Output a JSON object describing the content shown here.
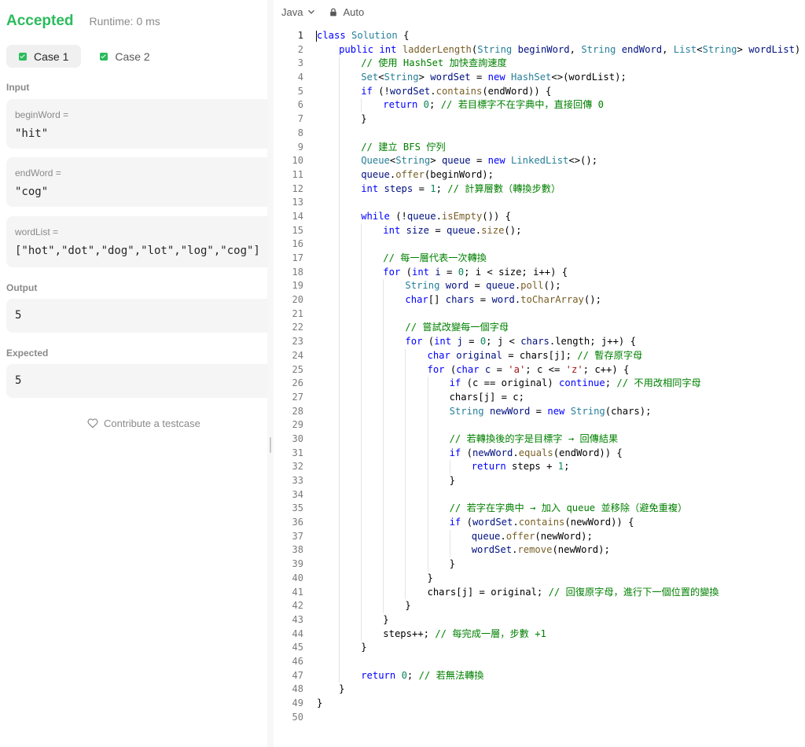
{
  "result": {
    "status": "Accepted",
    "runtime": "Runtime: 0 ms",
    "status_color": "#2cbb5d"
  },
  "cases": [
    {
      "label": "Case 1",
      "active": true
    },
    {
      "label": "Case 2",
      "active": false
    }
  ],
  "input": {
    "section_label": "Input",
    "params": [
      {
        "name": "beginWord =",
        "value": "\"hit\""
      },
      {
        "name": "endWord =",
        "value": "\"cog\""
      },
      {
        "name": "wordList =",
        "value": "[\"hot\",\"dot\",\"dog\",\"lot\",\"log\",\"cog\"]"
      }
    ]
  },
  "output": {
    "section_label": "Output",
    "value": "5"
  },
  "expected": {
    "section_label": "Expected",
    "value": "5"
  },
  "contribute_label": "Contribute a testcase",
  "editor": {
    "language": "Java",
    "mode": "Auto",
    "active_line": 1,
    "lines": [
      {
        "indent": 0,
        "tokens": [
          [
            "kw",
            "class"
          ],
          [
            "p",
            " "
          ],
          [
            "type",
            "Solution"
          ],
          [
            "p",
            " {"
          ]
        ]
      },
      {
        "indent": 1,
        "tokens": [
          [
            "kw",
            "public"
          ],
          [
            "p",
            " "
          ],
          [
            "kw",
            "int"
          ],
          [
            "p",
            " "
          ],
          [
            "fn",
            "ladderLength"
          ],
          [
            "p",
            "("
          ],
          [
            "type",
            "String"
          ],
          [
            "p",
            " "
          ],
          [
            "var",
            "beginWord"
          ],
          [
            "p",
            ", "
          ],
          [
            "type",
            "String"
          ],
          [
            "p",
            " "
          ],
          [
            "var",
            "endWord"
          ],
          [
            "p",
            ", "
          ],
          [
            "type",
            "List"
          ],
          [
            "p",
            "<"
          ],
          [
            "type",
            "String"
          ],
          [
            "p",
            "> "
          ],
          [
            "var",
            "wordList"
          ],
          [
            "p",
            ") {"
          ]
        ]
      },
      {
        "indent": 2,
        "tokens": [
          [
            "cm",
            "// 使用 HashSet 加快查詢速度"
          ]
        ]
      },
      {
        "indent": 2,
        "tokens": [
          [
            "type",
            "Set"
          ],
          [
            "p",
            "<"
          ],
          [
            "type",
            "String"
          ],
          [
            "p",
            "> "
          ],
          [
            "var",
            "wordSet"
          ],
          [
            "p",
            " = "
          ],
          [
            "kw",
            "new"
          ],
          [
            "p",
            " "
          ],
          [
            "type",
            "HashSet"
          ],
          [
            "p",
            "<>(wordList);"
          ]
        ]
      },
      {
        "indent": 2,
        "tokens": [
          [
            "kw",
            "if"
          ],
          [
            "p",
            " (!"
          ],
          [
            "var",
            "wordSet"
          ],
          [
            "p",
            "."
          ],
          [
            "fn",
            "contains"
          ],
          [
            "p",
            "(endWord)) {"
          ]
        ]
      },
      {
        "indent": 3,
        "tokens": [
          [
            "kw",
            "return"
          ],
          [
            "p",
            " "
          ],
          [
            "num",
            "0"
          ],
          [
            "p",
            "; "
          ],
          [
            "cm",
            "// 若目標字不在字典中，直接回傳 0"
          ]
        ]
      },
      {
        "indent": 2,
        "tokens": [
          [
            "p",
            "}"
          ]
        ]
      },
      {
        "indent": 0,
        "tokens": []
      },
      {
        "indent": 2,
        "tokens": [
          [
            "cm",
            "// 建立 BFS 佇列"
          ]
        ]
      },
      {
        "indent": 2,
        "tokens": [
          [
            "type",
            "Queue"
          ],
          [
            "p",
            "<"
          ],
          [
            "type",
            "String"
          ],
          [
            "p",
            "> "
          ],
          [
            "var",
            "queue"
          ],
          [
            "p",
            " = "
          ],
          [
            "kw",
            "new"
          ],
          [
            "p",
            " "
          ],
          [
            "type",
            "LinkedList"
          ],
          [
            "p",
            "<>();"
          ]
        ]
      },
      {
        "indent": 2,
        "tokens": [
          [
            "var",
            "queue"
          ],
          [
            "p",
            "."
          ],
          [
            "fn",
            "offer"
          ],
          [
            "p",
            "(beginWord);"
          ]
        ]
      },
      {
        "indent": 2,
        "tokens": [
          [
            "kw",
            "int"
          ],
          [
            "p",
            " "
          ],
          [
            "var",
            "steps"
          ],
          [
            "p",
            " = "
          ],
          [
            "num",
            "1"
          ],
          [
            "p",
            "; "
          ],
          [
            "cm",
            "// 計算層數（轉換步數）"
          ]
        ]
      },
      {
        "indent": 0,
        "tokens": []
      },
      {
        "indent": 2,
        "tokens": [
          [
            "kw",
            "while"
          ],
          [
            "p",
            " (!"
          ],
          [
            "var",
            "queue"
          ],
          [
            "p",
            "."
          ],
          [
            "fn",
            "isEmpty"
          ],
          [
            "p",
            "()) {"
          ]
        ]
      },
      {
        "indent": 3,
        "tokens": [
          [
            "kw",
            "int"
          ],
          [
            "p",
            " "
          ],
          [
            "var",
            "size"
          ],
          [
            "p",
            " = "
          ],
          [
            "var",
            "queue"
          ],
          [
            "p",
            "."
          ],
          [
            "fn",
            "size"
          ],
          [
            "p",
            "();"
          ]
        ]
      },
      {
        "indent": 0,
        "tokens": []
      },
      {
        "indent": 3,
        "tokens": [
          [
            "cm",
            "// 每一層代表一次轉換"
          ]
        ]
      },
      {
        "indent": 3,
        "tokens": [
          [
            "kw",
            "for"
          ],
          [
            "p",
            " ("
          ],
          [
            "kw",
            "int"
          ],
          [
            "p",
            " "
          ],
          [
            "var",
            "i"
          ],
          [
            "p",
            " = "
          ],
          [
            "num",
            "0"
          ],
          [
            "p",
            "; i < size; i++) {"
          ]
        ]
      },
      {
        "indent": 4,
        "tokens": [
          [
            "type",
            "String"
          ],
          [
            "p",
            " "
          ],
          [
            "var",
            "word"
          ],
          [
            "p",
            " = "
          ],
          [
            "var",
            "queue"
          ],
          [
            "p",
            "."
          ],
          [
            "fn",
            "poll"
          ],
          [
            "p",
            "();"
          ]
        ]
      },
      {
        "indent": 4,
        "tokens": [
          [
            "kw",
            "char"
          ],
          [
            "p",
            "[] "
          ],
          [
            "var",
            "chars"
          ],
          [
            "p",
            " = "
          ],
          [
            "var",
            "word"
          ],
          [
            "p",
            "."
          ],
          [
            "fn",
            "toCharArray"
          ],
          [
            "p",
            "();"
          ]
        ]
      },
      {
        "indent": 0,
        "tokens": []
      },
      {
        "indent": 4,
        "tokens": [
          [
            "cm",
            "// 嘗試改變每一個字母"
          ]
        ]
      },
      {
        "indent": 4,
        "tokens": [
          [
            "kw",
            "for"
          ],
          [
            "p",
            " ("
          ],
          [
            "kw",
            "int"
          ],
          [
            "p",
            " "
          ],
          [
            "var",
            "j"
          ],
          [
            "p",
            " = "
          ],
          [
            "num",
            "0"
          ],
          [
            "p",
            "; j < "
          ],
          [
            "var",
            "chars"
          ],
          [
            "p",
            ".length; j++) {"
          ]
        ]
      },
      {
        "indent": 5,
        "tokens": [
          [
            "kw",
            "char"
          ],
          [
            "p",
            " "
          ],
          [
            "var",
            "original"
          ],
          [
            "p",
            " = chars[j]; "
          ],
          [
            "cm",
            "// 暫存原字母"
          ]
        ]
      },
      {
        "indent": 5,
        "tokens": [
          [
            "kw",
            "for"
          ],
          [
            "p",
            " ("
          ],
          [
            "kw",
            "char"
          ],
          [
            "p",
            " "
          ],
          [
            "var",
            "c"
          ],
          [
            "p",
            " = "
          ],
          [
            "str",
            "'a'"
          ],
          [
            "p",
            "; c <= "
          ],
          [
            "str",
            "'z'"
          ],
          [
            "p",
            "; c++) {"
          ]
        ]
      },
      {
        "indent": 6,
        "tokens": [
          [
            "kw",
            "if"
          ],
          [
            "p",
            " (c == original) "
          ],
          [
            "kw",
            "continue"
          ],
          [
            "p",
            "; "
          ],
          [
            "cm",
            "// 不用改相同字母"
          ]
        ]
      },
      {
        "indent": 6,
        "tokens": [
          [
            "p",
            "chars[j] = c;"
          ]
        ]
      },
      {
        "indent": 6,
        "tokens": [
          [
            "type",
            "String"
          ],
          [
            "p",
            " "
          ],
          [
            "var",
            "newWord"
          ],
          [
            "p",
            " = "
          ],
          [
            "kw",
            "new"
          ],
          [
            "p",
            " "
          ],
          [
            "type",
            "String"
          ],
          [
            "p",
            "(chars);"
          ]
        ]
      },
      {
        "indent": 0,
        "tokens": []
      },
      {
        "indent": 6,
        "tokens": [
          [
            "cm",
            "// 若轉換後的字是目標字 → 回傳結果"
          ]
        ]
      },
      {
        "indent": 6,
        "tokens": [
          [
            "kw",
            "if"
          ],
          [
            "p",
            " ("
          ],
          [
            "var",
            "newWord"
          ],
          [
            "p",
            "."
          ],
          [
            "fn",
            "equals"
          ],
          [
            "p",
            "(endWord)) {"
          ]
        ]
      },
      {
        "indent": 7,
        "tokens": [
          [
            "kw",
            "return"
          ],
          [
            "p",
            " steps + "
          ],
          [
            "num",
            "1"
          ],
          [
            "p",
            ";"
          ]
        ]
      },
      {
        "indent": 6,
        "tokens": [
          [
            "p",
            "}"
          ]
        ]
      },
      {
        "indent": 0,
        "tokens": []
      },
      {
        "indent": 6,
        "tokens": [
          [
            "cm",
            "// 若字在字典中 → 加入 queue 並移除（避免重複）"
          ]
        ]
      },
      {
        "indent": 6,
        "tokens": [
          [
            "kw",
            "if"
          ],
          [
            "p",
            " ("
          ],
          [
            "var",
            "wordSet"
          ],
          [
            "p",
            "."
          ],
          [
            "fn",
            "contains"
          ],
          [
            "p",
            "(newWord)) {"
          ]
        ]
      },
      {
        "indent": 7,
        "tokens": [
          [
            "var",
            "queue"
          ],
          [
            "p",
            "."
          ],
          [
            "fn",
            "offer"
          ],
          [
            "p",
            "(newWord);"
          ]
        ]
      },
      {
        "indent": 7,
        "tokens": [
          [
            "var",
            "wordSet"
          ],
          [
            "p",
            "."
          ],
          [
            "fn",
            "remove"
          ],
          [
            "p",
            "(newWord);"
          ]
        ]
      },
      {
        "indent": 6,
        "tokens": [
          [
            "p",
            "}"
          ]
        ]
      },
      {
        "indent": 5,
        "tokens": [
          [
            "p",
            "}"
          ]
        ]
      },
      {
        "indent": 5,
        "tokens": [
          [
            "p",
            "chars[j] = original; "
          ],
          [
            "cm",
            "// 回復原字母，進行下一個位置的變換"
          ]
        ]
      },
      {
        "indent": 4,
        "tokens": [
          [
            "p",
            "}"
          ]
        ]
      },
      {
        "indent": 3,
        "tokens": [
          [
            "p",
            "}"
          ]
        ]
      },
      {
        "indent": 3,
        "tokens": [
          [
            "p",
            "steps++; "
          ],
          [
            "cm",
            "// 每完成一層，步數 +1"
          ]
        ]
      },
      {
        "indent": 2,
        "tokens": [
          [
            "p",
            "}"
          ]
        ]
      },
      {
        "indent": 0,
        "tokens": []
      },
      {
        "indent": 2,
        "tokens": [
          [
            "kw",
            "return"
          ],
          [
            "p",
            " "
          ],
          [
            "num",
            "0"
          ],
          [
            "p",
            "; "
          ],
          [
            "cm",
            "// 若無法轉換"
          ]
        ]
      },
      {
        "indent": 1,
        "tokens": [
          [
            "p",
            "}"
          ]
        ]
      },
      {
        "indent": 0,
        "tokens": [
          [
            "p",
            "}"
          ]
        ]
      },
      {
        "indent": 0,
        "tokens": []
      }
    ]
  }
}
